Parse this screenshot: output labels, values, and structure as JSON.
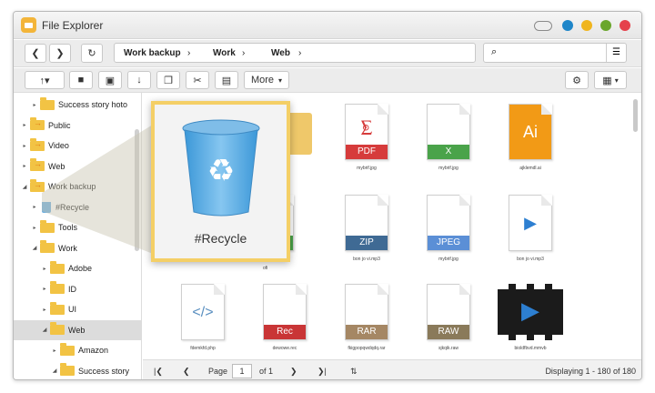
{
  "window": {
    "title": "File Explorer"
  },
  "colors": {
    "blue": "#1e86c9",
    "yellow": "#f0b51e",
    "green": "#6aa62c",
    "red": "#e5414b",
    "pdf": "#d63b3b",
    "x": "#4aa34a",
    "jpeg": "#5b8fd6",
    "zip": "#3f6a94",
    "rar": "#a58764",
    "rec": "#c93536",
    "raw": "#8a7a5a",
    "ai": "#f29a16",
    "play": "#2d7fd1"
  },
  "breadcrumbs": [
    "Work backup",
    "Work",
    "Web"
  ],
  "toolbar": {
    "more_label": "More"
  },
  "sidebar": {
    "items": [
      {
        "label": "Success story hoto",
        "icon": "folder-icon",
        "level": 2,
        "arrow": "▸"
      },
      {
        "label": "Public",
        "icon": "shared-folder-icon",
        "level": 1,
        "arrow": "▸"
      },
      {
        "label": "Video",
        "icon": "shared-folder-icon",
        "level": 1,
        "arrow": "▸"
      },
      {
        "label": "Web",
        "icon": "shared-folder-icon",
        "level": 1,
        "arrow": "▸"
      },
      {
        "label": "Work backup",
        "icon": "shared-folder-icon",
        "level": 1,
        "arrow": "◢"
      },
      {
        "label": "#Recycle",
        "icon": "recycle-bin-icon",
        "level": 2,
        "arrow": "▸"
      },
      {
        "label": "Tools",
        "icon": "folder-icon",
        "level": 2,
        "arrow": "▸"
      },
      {
        "label": "Work",
        "icon": "folder-icon",
        "level": 2,
        "arrow": "◢"
      },
      {
        "label": "Adobe",
        "icon": "folder-icon",
        "level": 3,
        "arrow": "▸"
      },
      {
        "label": "ID",
        "icon": "folder-icon",
        "level": 3,
        "arrow": "▸"
      },
      {
        "label": "UI",
        "icon": "folder-icon",
        "level": 3,
        "arrow": "▸"
      },
      {
        "label": "Web",
        "icon": "folder-icon",
        "level": 3,
        "arrow": "◢",
        "selected": true
      },
      {
        "label": "Amazon",
        "icon": "folder-icon",
        "level": 4,
        "arrow": "▸"
      },
      {
        "label": "Success story",
        "icon": "folder-icon",
        "level": 4,
        "arrow": "◢"
      }
    ]
  },
  "files": [
    {
      "name": "",
      "badge": "",
      "kind": "folder"
    },
    {
      "name": "mybrif.jpg",
      "badge": "PDF",
      "kind": "pdf"
    },
    {
      "name": "mybrif.jpg",
      "badge": "X",
      "kind": "x"
    },
    {
      "name": "ajklemdl.ai",
      "badge": "Ai",
      "kind": "ai"
    },
    {
      "name": "",
      "badge": "V",
      "kind": "partial"
    },
    {
      "name": "bon jo vi.mp3",
      "badge": "ZIP",
      "kind": "zip"
    },
    {
      "name": "mybrif.jpg",
      "badge": "JPEG",
      "kind": "jpeg"
    },
    {
      "name": "bon jo vi.mp3",
      "badge": "",
      "kind": "play"
    },
    {
      "name": "fdemkfd.php",
      "badge": "</>",
      "kind": "code"
    },
    {
      "name": "dewowe.rec",
      "badge": "Rec",
      "kind": "rec"
    },
    {
      "name": "fkigpopqwdqdq.rar",
      "badge": "RAR",
      "kind": "rar"
    },
    {
      "name": "sjkqik.raw",
      "badge": "RAW",
      "kind": "raw"
    },
    {
      "name": "bioldfbvd.mmvb",
      "badge": "",
      "kind": "video"
    }
  ],
  "partial_label": "ofi",
  "footer": {
    "page_label": "Page",
    "page_value": "1",
    "of_label": "of 1",
    "status": "Displaying 1 - 180 of 180"
  },
  "zoom": {
    "label": "#Recycle"
  }
}
